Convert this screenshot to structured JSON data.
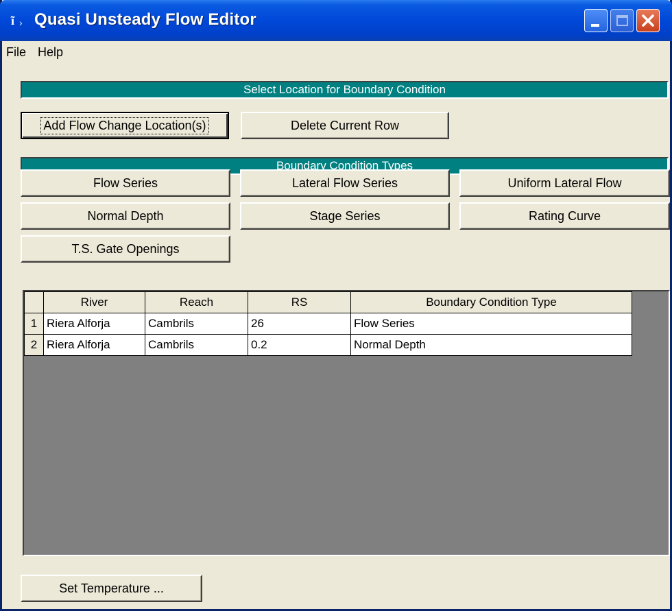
{
  "window": {
    "title": "Quasi Unsteady Flow Editor",
    "app_icon": "hec-ras-icon",
    "controls": [
      "minimize-icon",
      "maximize-icon",
      "close-icon"
    ]
  },
  "menu": {
    "file_label": "File",
    "help_label": "Help"
  },
  "location_section": {
    "header": "Select Location for Boundary Condition",
    "add_button": "Add Flow Change Location(s)",
    "delete_button": "Delete Current Row"
  },
  "bc_types_section": {
    "header": "Boundary Condition Types",
    "buttons": [
      "Flow Series",
      "Lateral Flow Series",
      "Uniform Lateral Flow",
      "Normal Depth",
      "Stage Series",
      "Rating Curve",
      "T.S. Gate Openings"
    ]
  },
  "table": {
    "columns": [
      "River",
      "Reach",
      "RS",
      "Boundary Condition Type"
    ],
    "rows": [
      {
        "num": "1",
        "river": "Riera Alforja",
        "reach": "Cambrils",
        "rs": "26",
        "bc_type": "Flow Series"
      },
      {
        "num": "2",
        "river": "Riera Alforja",
        "reach": "Cambrils",
        "rs": "0.2",
        "bc_type": "Normal Depth"
      }
    ]
  },
  "footer": {
    "set_temperature_button": "Set Temperature ..."
  },
  "colors": {
    "title_bar": "#0048d8",
    "section_header": "#008080",
    "window_bg": "#ece9d8",
    "grid_bg": "#808080"
  }
}
